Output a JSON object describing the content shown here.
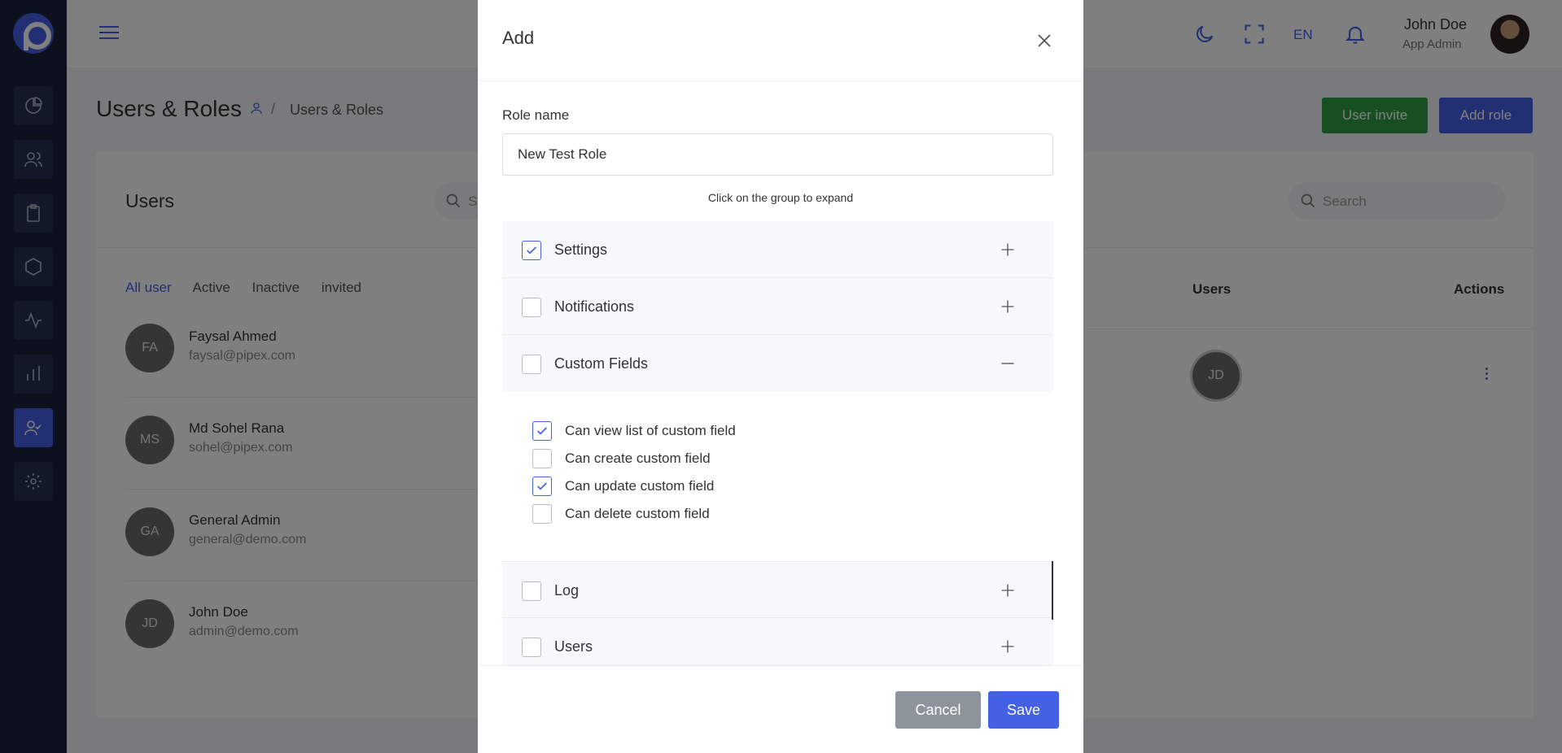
{
  "topbar": {
    "language": "EN",
    "user_name": "John Doe",
    "user_role": "App Admin"
  },
  "page": {
    "title": "Users & Roles",
    "breadcrumb_current": "Users & Roles",
    "breadcrumb_separator": "/",
    "user_invite_label": "User invite",
    "add_role_label": "Add role"
  },
  "users_card": {
    "title": "Users",
    "search_placeholder": "Search",
    "filters": [
      "All user",
      "Active",
      "Inactive",
      "invited"
    ],
    "users": [
      {
        "initials": "FA",
        "name": "Faysal Ahmed",
        "email": "faysal@pipex.com"
      },
      {
        "initials": "MS",
        "name": "Md Sohel Rana",
        "email": "sohel@pipex.com"
      },
      {
        "initials": "GA",
        "name": "General Admin",
        "email": "general@demo.com"
      },
      {
        "initials": "JD",
        "name": "John Doe",
        "email": "admin@demo.com"
      }
    ]
  },
  "roles_card": {
    "search_placeholder": "Search",
    "col_users": "Users",
    "col_actions": "Actions",
    "row_user_initials": "JD"
  },
  "modal": {
    "title": "Add",
    "role_name_label": "Role name",
    "role_name_value": "New Test Role",
    "hint": "Click on the group to expand",
    "groups": [
      {
        "label": "Settings",
        "checked": true,
        "expanded": false
      },
      {
        "label": "Notifications",
        "checked": false,
        "expanded": false
      },
      {
        "label": "Custom Fields",
        "checked": false,
        "expanded": true
      },
      {
        "label": "Log",
        "checked": false,
        "expanded": false
      },
      {
        "label": "Users",
        "checked": false,
        "expanded": false
      }
    ],
    "custom_field_permissions": [
      {
        "label": "Can view list of custom field",
        "checked": true
      },
      {
        "label": "Can create custom field",
        "checked": false
      },
      {
        "label": "Can update custom field",
        "checked": true
      },
      {
        "label": "Can delete custom field",
        "checked": false
      }
    ],
    "cancel_label": "Cancel",
    "save_label": "Save"
  },
  "colors": {
    "accent": "#4461e6",
    "success": "#2e9e44",
    "sidebar": "#19233b"
  }
}
